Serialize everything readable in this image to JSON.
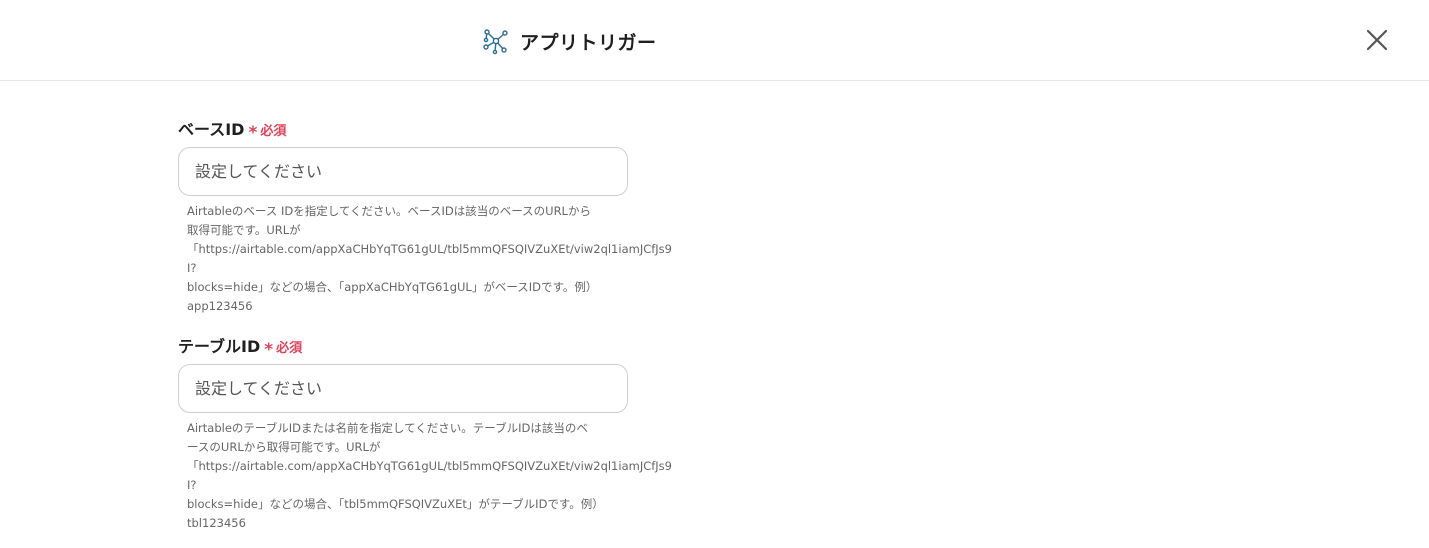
{
  "header": {
    "title": "アプリトリガー",
    "icon": "app-trigger-network-icon",
    "close_icon": "close-icon"
  },
  "fields": [
    {
      "label": "ベースID",
      "required_mark": "*",
      "required_text": "必須",
      "placeholder": "設定してください",
      "value": "",
      "help": "Airtableのベース IDを指定してください。ベースIDは該当のベースのURLから\n取得可能です。URLが\n「https://airtable.com/appXaCHbYqTG61gUL/tbl5mmQFSQIVZuXEt/viw2ql1iamJCfJs9I?\nblocks=hide」などの場合、「appXaCHbYqTG61gUL」がベースIDです。例）\napp123456"
    },
    {
      "label": "テーブルID",
      "required_mark": "*",
      "required_text": "必須",
      "placeholder": "設定してください",
      "value": "",
      "help": "AirtableのテーブルIDまたは名前を指定してください。テーブルIDは該当のベ\nースのURLから取得可能です。URLが\n「https://airtable.com/appXaCHbYqTG61gUL/tbl5mmQFSQIVZuXEt/viw2ql1iamJCfJs9I?\nblocks=hide」などの場合、「tbl5mmQFSQIVZuXEt」がテーブルIDです。例）\ntbl123456"
    }
  ],
  "colors": {
    "required": "#e0445a",
    "icon_accent": "#2a6f97"
  }
}
